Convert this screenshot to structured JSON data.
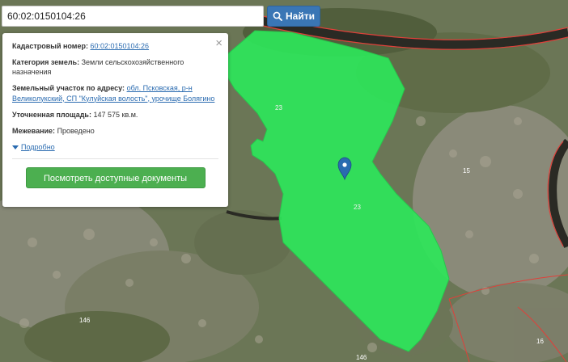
{
  "search": {
    "value": "60:02:0150104:26",
    "button_label": "Найти"
  },
  "popup": {
    "close_glyph": "×",
    "cadastral_label": "Кадастровый номер:",
    "cadastral_value": "60:02:0150104:26",
    "category_label": "Категория земель:",
    "category_value": "Земли сельскохозяйственного назначения",
    "address_label": "Земельный участок по адресу:",
    "address_value": "обл. Псковская, р-н Великолукский, СП \"Кулуйская волость\", урочище Болягино",
    "area_label": "Уточненная площадь:",
    "area_value": "147 575 кв.м.",
    "survey_label": "Межевание:",
    "survey_value": "Проведено",
    "more_label": "Подробно",
    "docs_button": "Посмотреть доступные документы"
  },
  "map": {
    "parcel_labels": [
      "23",
      "23",
      "15",
      "146",
      "146",
      "16"
    ],
    "parcel_fill": "#2ee65a",
    "boundary_color": "#e0403a",
    "marker_color": "#2a6bb0"
  }
}
